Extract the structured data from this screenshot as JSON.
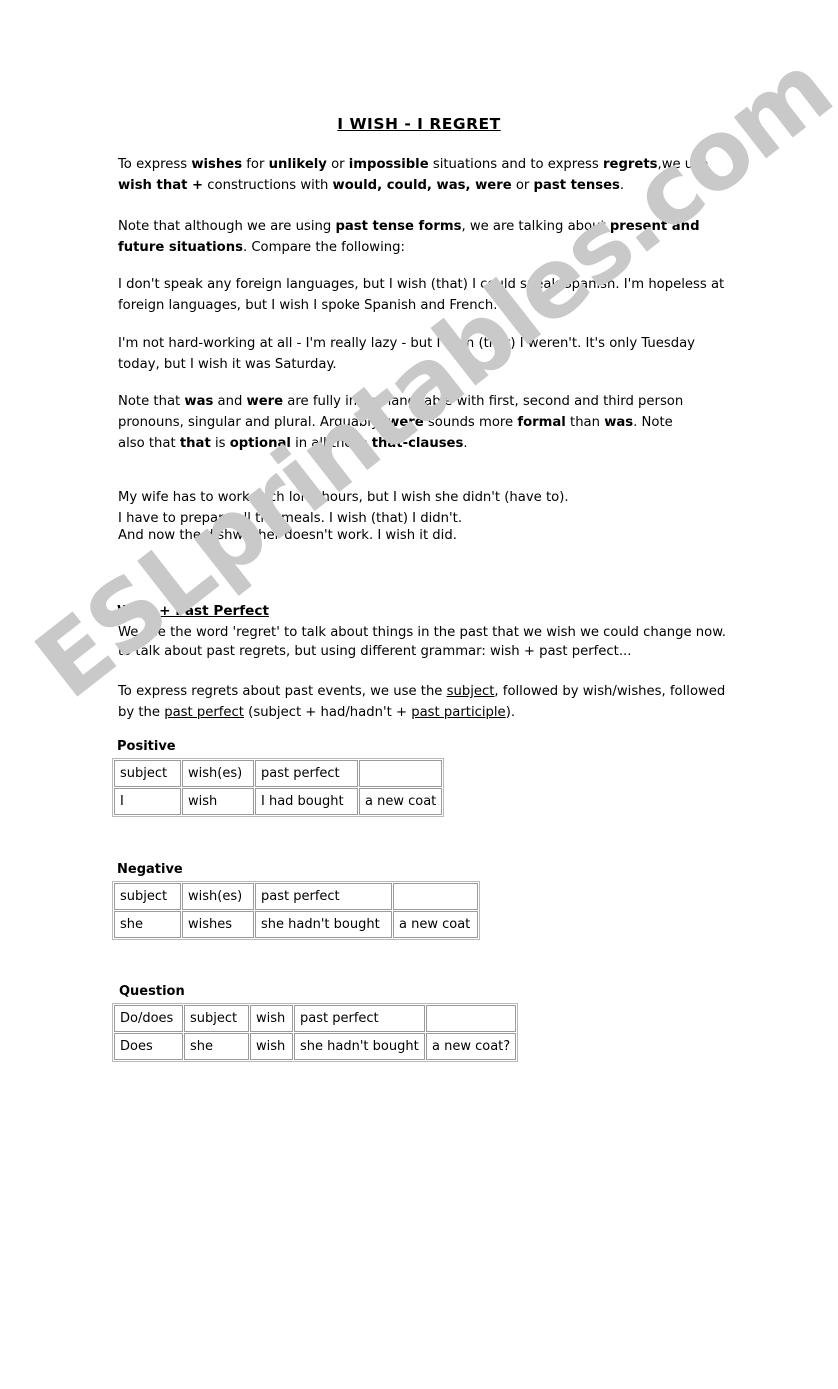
{
  "document": {
    "title": "I WISH  -  I REGRET",
    "watermark": "ESLprintables.com",
    "watermark_color": "#c9c9c9"
  },
  "intro": {
    "p1_a": "To express ",
    "p1_b1": "wishes",
    "p1_c": " for ",
    "p1_b2": "unlikely",
    "p1_d": " or ",
    "p1_b3": "impossible",
    "p1_e": " situations and to express ",
    "p1_b4": "regrets",
    "p1_f": ",we use ",
    "p1_b5": "wish that +",
    "p1_g": " constructions with ",
    "p1_b6": "would,  could,  was,  were",
    "p1_h": " or ",
    "p1_b7": "past tenses",
    "p1_i": ".",
    "p2_a": "Note that although we are using ",
    "p2_b1": "past tense forms",
    "p2_c": ", we are talking about ",
    "p2_b2": "present and future situations",
    "p2_d": ". Compare the following:"
  },
  "examples": {
    "ex1": " I don't speak any foreign languages, but I wish (that) I could speak Spanish. I'm hopeless at foreign languages, but I wish I spoke Spanish and French.",
    "ex2": "I'm not hard-working at all - I'm really lazy - but I wish (that) I weren't. It's only Tuesday today, but I wish it was Saturday.",
    "note_a": " Note that ",
    "note_b1": "was",
    "note_c": " and ",
    "note_b2": "were",
    "note_d": " are fully interchangeable with first, second and third person pronouns, singular and plural. Arguably, ",
    "note_b3": "were",
    "note_e": " sounds more ",
    "note_b4": "formal",
    "note_f": " than ",
    "note_b5": "was",
    "note_g": ". Note also that ",
    "note_b6": "that",
    "note_h": " is ",
    "note_b7": "optional",
    "note_i": " in all these ",
    "note_b8": "that-clauses",
    "note_j": ".",
    "list1": "My wife has to work such long hours, but I wish she didn't (have to).",
    "list2": "I have to prepare all the meals. I wish (that) I didn't.",
    "list3": "And now the dishwasher doesn't work. I wish it did."
  },
  "past_perfect": {
    "heading": "Wish + Past Perfect",
    "line1": "We use the word 'regret' to talk about things in the past that we wish we could change now.",
    "line2": " to talk about  past regrets, but using different grammar: wish + past perfect...",
    "p_a": "To express regrets about past events, we use the ",
    "p_u1": "subject",
    "p_b": ", followed by wish/wishes, followed by the ",
    "p_u2": "past perfect",
    "p_c": " (subject + had/hadn't + ",
    "p_u3": "past participle",
    "p_d": ")."
  },
  "tables": [
    {
      "label": "Positive",
      "rows": [
        [
          "subject",
          "wish(es)",
          "past perfect",
          ""
        ],
        [
          "I",
          "wish",
          "I had bought",
          "a new coat"
        ]
      ]
    },
    {
      "label": "Negative",
      "rows": [
        [
          "subject",
          "wish(es)",
          "past perfect",
          ""
        ],
        [
          "she",
          "wishes",
          "she hadn't bought",
          "a new coat"
        ]
      ]
    },
    {
      "label": "Question",
      "rows": [
        [
          "Do/does",
          "subject",
          "wish",
          "past perfect",
          ""
        ],
        [
          "Does",
          "she",
          "wish",
          "she hadn't bought",
          "a new coat?"
        ]
      ]
    }
  ]
}
